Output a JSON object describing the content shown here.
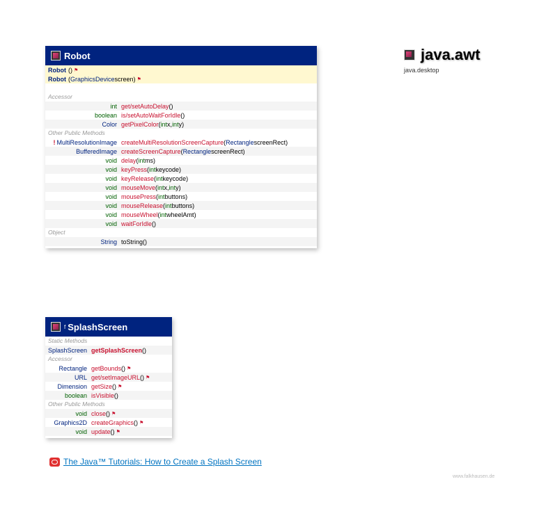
{
  "package": {
    "name": "java.awt",
    "module": "java.desktop"
  },
  "robot": {
    "title": "Robot",
    "constructors": [
      {
        "name": "Robot",
        "params": "()",
        "note": "⚑"
      },
      {
        "name": "Robot",
        "params_open": "(",
        "ptype": "GraphicsDevice",
        "pname": " screen)",
        "note": "⚑"
      }
    ],
    "accessor_label": "Accessor",
    "accessors": [
      {
        "type": "int",
        "prim": true,
        "method": "get/setAutoDelay",
        "args": " ()"
      },
      {
        "type": "boolean",
        "prim": true,
        "method": "is/setAutoWaitForIdle",
        "args": " ()"
      },
      {
        "type": "Color",
        "prim": false,
        "method": "getPixelColor",
        "args_open": " (",
        "a1t": "int",
        "a1n": " x, ",
        "a2t": "int",
        "a2n": " y)"
      }
    ],
    "other_label": "Other Public Methods",
    "others": [
      {
        "warn": "!",
        "type": "MultiResolutionImage",
        "method": "createMultiResolutionScreenCapture",
        "args_open": " (",
        "a1t": "Rectangle",
        "a1n": " screenRect)"
      },
      {
        "type": "BufferedImage",
        "method": "createScreenCapture",
        "args_open": " (",
        "a1t": "Rectangle",
        "a1n": " screenRect)"
      },
      {
        "type": "void",
        "method": "delay",
        "args_open": " (",
        "a1t": "int",
        "a1n": " ms)"
      },
      {
        "type": "void",
        "method": "keyPress",
        "args_open": " (",
        "a1t": "int",
        "a1n": " keycode)"
      },
      {
        "type": "void",
        "method": "keyRelease",
        "args_open": " (",
        "a1t": "int",
        "a1n": " keycode)"
      },
      {
        "type": "void",
        "method": "mouseMove",
        "args_open": " (",
        "a1t": "int",
        "a1n": " x, ",
        "a2t": "int",
        "a2n": " y)"
      },
      {
        "type": "void",
        "method": "mousePress",
        "args_open": " (",
        "a1t": "int",
        "a1n": " buttons)"
      },
      {
        "type": "void",
        "method": "mouseRelease",
        "args_open": " (",
        "a1t": "int",
        "a1n": " buttons)"
      },
      {
        "type": "void",
        "method": "mouseWheel",
        "args_open": " (",
        "a1t": "int",
        "a1n": " wheelAmt)"
      },
      {
        "type": "void",
        "method": "waitForIdle",
        "args": " ()"
      }
    ],
    "object_label": "Object",
    "object_methods": [
      {
        "type": "String",
        "method": "toString",
        "args": " ()"
      }
    ]
  },
  "splash": {
    "final_mark": "f",
    "title": "SplashScreen",
    "static_label": "Static Methods",
    "statics": [
      {
        "type": "SplashScreen",
        "method": "getSplashScreen",
        "args": " ()"
      }
    ],
    "accessor_label": "Accessor",
    "accessors": [
      {
        "type": "Rectangle",
        "prim": false,
        "method": "getBounds",
        "args": " ()",
        "note": "⚑"
      },
      {
        "type": "URL",
        "prim": false,
        "method": "get/setImageURL",
        "args": " ()",
        "note": "⚑"
      },
      {
        "type": "Dimension",
        "prim": false,
        "method": "getSize",
        "args": " ()",
        "note": "⚑"
      },
      {
        "type": "boolean",
        "prim": true,
        "method": "isVisible",
        "args": " ()"
      }
    ],
    "other_label": "Other Public Methods",
    "others": [
      {
        "type": "void",
        "prim": true,
        "method": "close",
        "args": " ()",
        "note": "⚑"
      },
      {
        "type": "Graphics2D",
        "prim": false,
        "method": "createGraphics",
        "args": " ()",
        "note": "⚑"
      },
      {
        "type": "void",
        "prim": true,
        "method": "update",
        "args": " ()",
        "note": "⚑"
      }
    ]
  },
  "tutorial_link": "The Java™ Tutorials: How to Create a Splash Screen",
  "footer": "www.falkhausen.de"
}
